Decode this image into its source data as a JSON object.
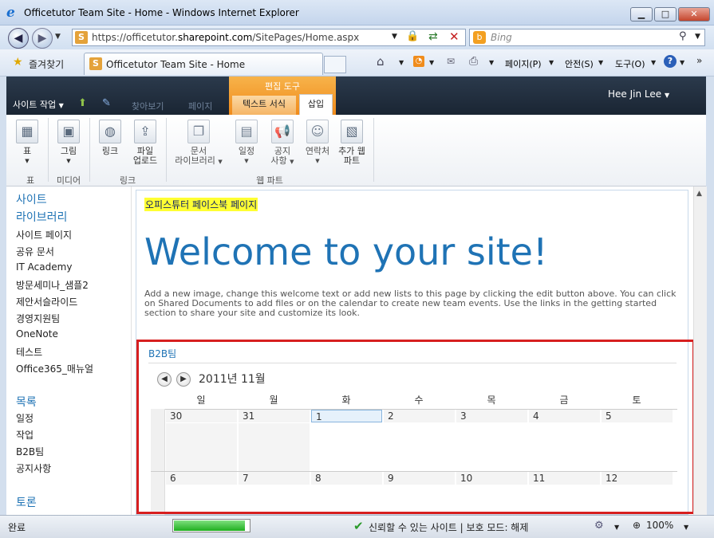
{
  "window": {
    "title": "Officetutor Team Site - Home - Windows Internet Explorer"
  },
  "address": {
    "url_prefix": "https://officetutor.",
    "url_domain": "sharepoint.com",
    "url_path": "/SitePages/Home.aspx",
    "search_placeholder": "Bing"
  },
  "favorites": {
    "label": "즐겨찾기",
    "tab_title": "Officetutor Team Site - Home"
  },
  "commands": {
    "page": "페이지(P)",
    "safety": "안전(S)",
    "tools": "도구(O)"
  },
  "ribbon": {
    "site_actions": "사이트 작업",
    "browse": "찾아보기",
    "page": "페이지",
    "edit_tools": "편집 도구",
    "text_format": "텍스트 서식",
    "insert": "삽입",
    "user": "Hee Jin Lee",
    "buttons": {
      "table": "표",
      "picture": "그림",
      "link": "링크",
      "upload_1": "파일",
      "upload_2": "업로드",
      "doclib_1": "문서",
      "doclib_2": "라이브러리",
      "calendar": "일정",
      "announce_1": "공지",
      "announce_2": "사항",
      "contacts": "연락처",
      "add_part_1": "추가 웹",
      "add_part_2": "파트"
    },
    "groups": {
      "table": "표",
      "media": "미디어",
      "links": "링크",
      "webparts": "웹 파트"
    }
  },
  "nav": {
    "heading_site": "사이트",
    "heading_lib": "라이브러리",
    "lib_items": [
      "사이트 페이지",
      "공유 문서",
      "IT Academy",
      "방문세미나_샘플2",
      "제안서슬라이드",
      "경영지원팀",
      "OneNote",
      "테스트",
      "Office365_매뉴얼"
    ],
    "heading_lists": "목록",
    "list_items": [
      "일정",
      "작업",
      "B2B팀",
      "공지사항"
    ],
    "heading_discuss": "토론"
  },
  "content": {
    "fb_link": "오피스튜터 페이스북 페이지",
    "welcome": "Welcome to your site!",
    "description": "Add a new image, change this welcome text or add new lists to this page by clicking the edit button above. You can click on Shared Documents to add files or on the calendar to create new team events. Use the links in the getting started section to share your site and customize its look."
  },
  "calendar": {
    "title": "B2B팀",
    "month": "2011년 11월",
    "weekdays": [
      "일",
      "월",
      "화",
      "수",
      "목",
      "금",
      "토"
    ],
    "week1": [
      "30",
      "31",
      "1",
      "2",
      "3",
      "4",
      "5"
    ],
    "week2": [
      "6",
      "7",
      "8",
      "9",
      "10",
      "11",
      "12"
    ]
  },
  "status": {
    "text": "완료",
    "trusted": "신뢰할 수 있는 사이트 | 보호 모드: 해제",
    "zoom": "100%",
    "progress": 0.95
  }
}
